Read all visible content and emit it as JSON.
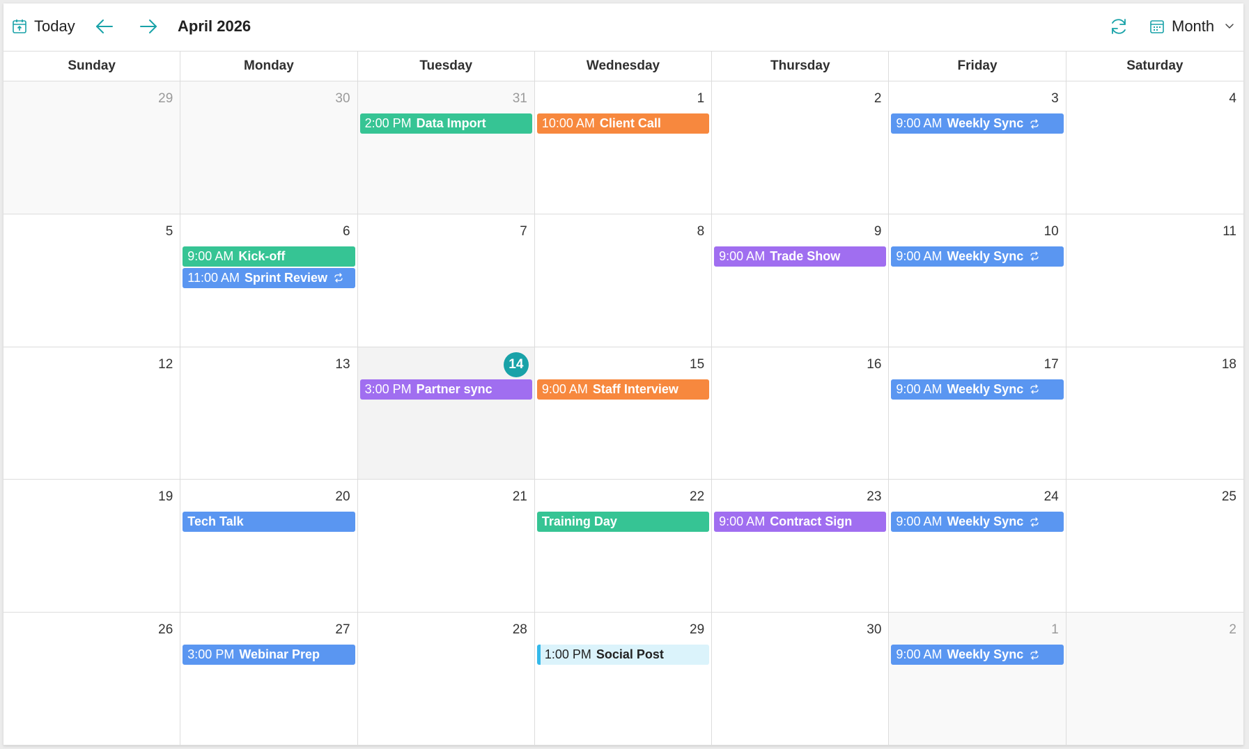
{
  "toolbar": {
    "today_label": "Today",
    "title": "April 2026",
    "view_label": "Month",
    "accent": "#18a2a8"
  },
  "weekdays": [
    "Sunday",
    "Monday",
    "Tuesday",
    "Wednesday",
    "Thursday",
    "Friday",
    "Saturday"
  ],
  "colors": {
    "teal": "#36c494",
    "orange": "#f7883e",
    "blue": "#5a96f1",
    "purple": "#a06ef0",
    "light": "#dbf3fb",
    "today_badge": "#18a2a8"
  },
  "weeks": [
    [
      {
        "day": "29",
        "other": true,
        "events": []
      },
      {
        "day": "30",
        "other": true,
        "events": []
      },
      {
        "day": "31",
        "other": true,
        "events": [
          {
            "time": "2:00 PM",
            "subject": "Data Import",
            "color": "teal"
          }
        ]
      },
      {
        "day": "1",
        "events": [
          {
            "time": "10:00 AM",
            "subject": "Client Call",
            "color": "orange"
          }
        ]
      },
      {
        "day": "2",
        "events": []
      },
      {
        "day": "3",
        "events": [
          {
            "time": "9:00 AM",
            "subject": "Weekly Sync",
            "color": "blue",
            "recurring": true
          }
        ]
      },
      {
        "day": "4",
        "events": []
      }
    ],
    [
      {
        "day": "5",
        "events": []
      },
      {
        "day": "6",
        "events": [
          {
            "time": "9:00 AM",
            "subject": "Kick-off",
            "color": "teal"
          },
          {
            "time": "11:00 AM",
            "subject": "Sprint Review",
            "color": "blue",
            "recurring": true
          }
        ]
      },
      {
        "day": "7",
        "events": []
      },
      {
        "day": "8",
        "events": []
      },
      {
        "day": "9",
        "events": [
          {
            "time": "9:00 AM",
            "subject": "Trade Show",
            "color": "purple"
          }
        ]
      },
      {
        "day": "10",
        "events": [
          {
            "time": "9:00 AM",
            "subject": "Weekly Sync",
            "color": "blue",
            "recurring": true
          }
        ]
      },
      {
        "day": "11",
        "events": []
      }
    ],
    [
      {
        "day": "12",
        "events": []
      },
      {
        "day": "13",
        "events": []
      },
      {
        "day": "14",
        "today": true,
        "events": [
          {
            "time": "3:00 PM",
            "subject": "Partner sync",
            "color": "purple"
          }
        ]
      },
      {
        "day": "15",
        "events": [
          {
            "time": "9:00 AM",
            "subject": "Staff Interview",
            "color": "orange"
          }
        ]
      },
      {
        "day": "16",
        "events": []
      },
      {
        "day": "17",
        "events": [
          {
            "time": "9:00 AM",
            "subject": "Weekly Sync",
            "color": "blue",
            "recurring": true
          }
        ]
      },
      {
        "day": "18",
        "events": []
      }
    ],
    [
      {
        "day": "19",
        "events": []
      },
      {
        "day": "20",
        "events": [
          {
            "time": "",
            "subject": "Tech Talk",
            "color": "blue"
          }
        ]
      },
      {
        "day": "21",
        "events": []
      },
      {
        "day": "22",
        "events": [
          {
            "time": "",
            "subject": "Training Day",
            "color": "teal"
          }
        ]
      },
      {
        "day": "23",
        "events": [
          {
            "time": "9:00 AM",
            "subject": "Contract Sign",
            "color": "purple"
          }
        ]
      },
      {
        "day": "24",
        "events": [
          {
            "time": "9:00 AM",
            "subject": "Weekly Sync",
            "color": "blue",
            "recurring": true
          }
        ]
      },
      {
        "day": "25",
        "events": []
      }
    ],
    [
      {
        "day": "26",
        "events": []
      },
      {
        "day": "27",
        "events": [
          {
            "time": "3:00 PM",
            "subject": "Webinar Prep",
            "color": "blue"
          }
        ]
      },
      {
        "day": "28",
        "events": []
      },
      {
        "day": "29",
        "events": [
          {
            "time": "1:00 PM",
            "subject": "Social Post",
            "color": "light"
          }
        ]
      },
      {
        "day": "30",
        "events": []
      },
      {
        "day": "1",
        "other": true,
        "events": [
          {
            "time": "9:00 AM",
            "subject": "Weekly Sync",
            "color": "blue",
            "recurring": true
          }
        ]
      },
      {
        "day": "2",
        "other": true,
        "events": []
      }
    ]
  ]
}
